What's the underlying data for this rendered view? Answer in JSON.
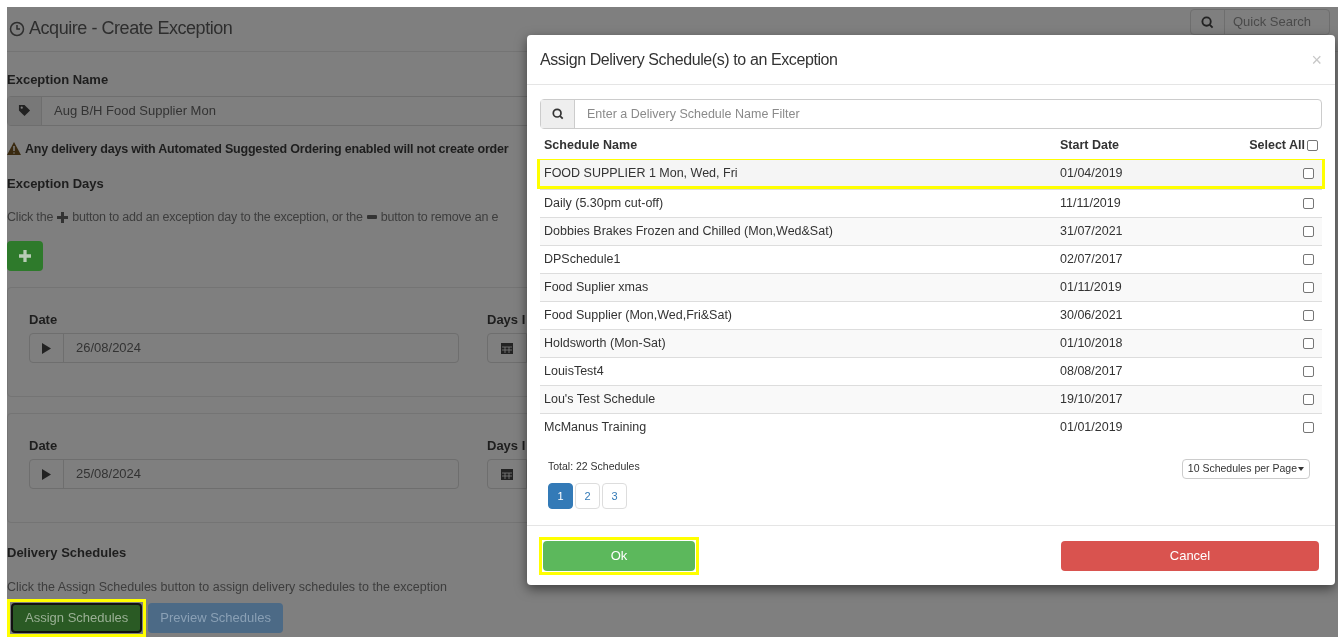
{
  "page": {
    "title": "Acquire - Create Exception",
    "quick_search": {
      "placeholder": "Quick Search"
    },
    "exception_name": {
      "label": "Exception Name",
      "value": "Aug B/H Food Supplier Mon"
    },
    "warning": "Any delivery days with Automated Suggested Ordering enabled will not create order",
    "exception_days": {
      "label": "Exception Days",
      "hint_parts": [
        "Click the",
        "button to add an exception day to the exception, or the",
        "button to remove an e"
      ],
      "days": [
        {
          "date_label": "Date",
          "date": "26/08/2024",
          "days_label": "Days I"
        },
        {
          "date_label": "Date",
          "date": "25/08/2024",
          "days_label": "Days I"
        }
      ]
    },
    "delivery_schedules": {
      "label": "Delivery Schedules",
      "hint": "Click the Assign Schedules button to assign delivery schedules to the exception",
      "buttons": [
        {
          "label": "Assign Schedules",
          "kind": "assign",
          "highlighted": true
        },
        {
          "label": "Preview Schedules",
          "kind": "preview",
          "highlighted": false
        }
      ]
    }
  },
  "modal": {
    "title": "Assign Delivery Schedule(s) to an Exception",
    "close": "×",
    "filter": {
      "placeholder": "Enter a Delivery Schedule Name Filter"
    },
    "columns": [
      "Schedule Name",
      "Start Date",
      "Select All"
    ],
    "select_all_checked": false,
    "rows": [
      {
        "name": "FOOD SUPPLIER 1 Mon, Wed, Fri",
        "start": "01/04/2019",
        "checked": false,
        "highlighted": true
      },
      {
        "name": "Daily (5.30pm cut-off)",
        "start": "11/11/2019",
        "checked": false,
        "highlighted": false
      },
      {
        "name": "Dobbies Brakes Frozen and Chilled (Mon,Wed&Sat)",
        "start": "31/07/2021",
        "checked": false,
        "highlighted": false
      },
      {
        "name": "DPSchedule1",
        "start": "02/07/2017",
        "checked": false,
        "highlighted": false
      },
      {
        "name": "Food Suplier xmas",
        "start": "01/11/2019",
        "checked": false,
        "highlighted": false
      },
      {
        "name": "Food Supplier (Mon,Wed,Fri&Sat)",
        "start": "30/06/2021",
        "checked": false,
        "highlighted": false
      },
      {
        "name": "Holdsworth (Mon-Sat)",
        "start": "01/10/2018",
        "checked": false,
        "highlighted": false
      },
      {
        "name": "LouisTest4",
        "start": "08/08/2017",
        "checked": false,
        "highlighted": false
      },
      {
        "name": "Lou's Test Schedule",
        "start": "19/10/2017",
        "checked": false,
        "highlighted": false
      },
      {
        "name": "McManus Training",
        "start": "01/01/2019",
        "checked": false,
        "highlighted": false
      }
    ],
    "total": "Total: 22 Schedules",
    "per_page": "10 Schedules per Page",
    "pages": [
      {
        "label": "1",
        "selected": true
      },
      {
        "label": "2",
        "selected": false
      },
      {
        "label": "3",
        "selected": false
      }
    ],
    "buttons": [
      {
        "label": "Ok",
        "kind": "ok",
        "highlighted": true
      },
      {
        "label": "Cancel",
        "kind": "cancel",
        "highlighted": false
      }
    ]
  }
}
